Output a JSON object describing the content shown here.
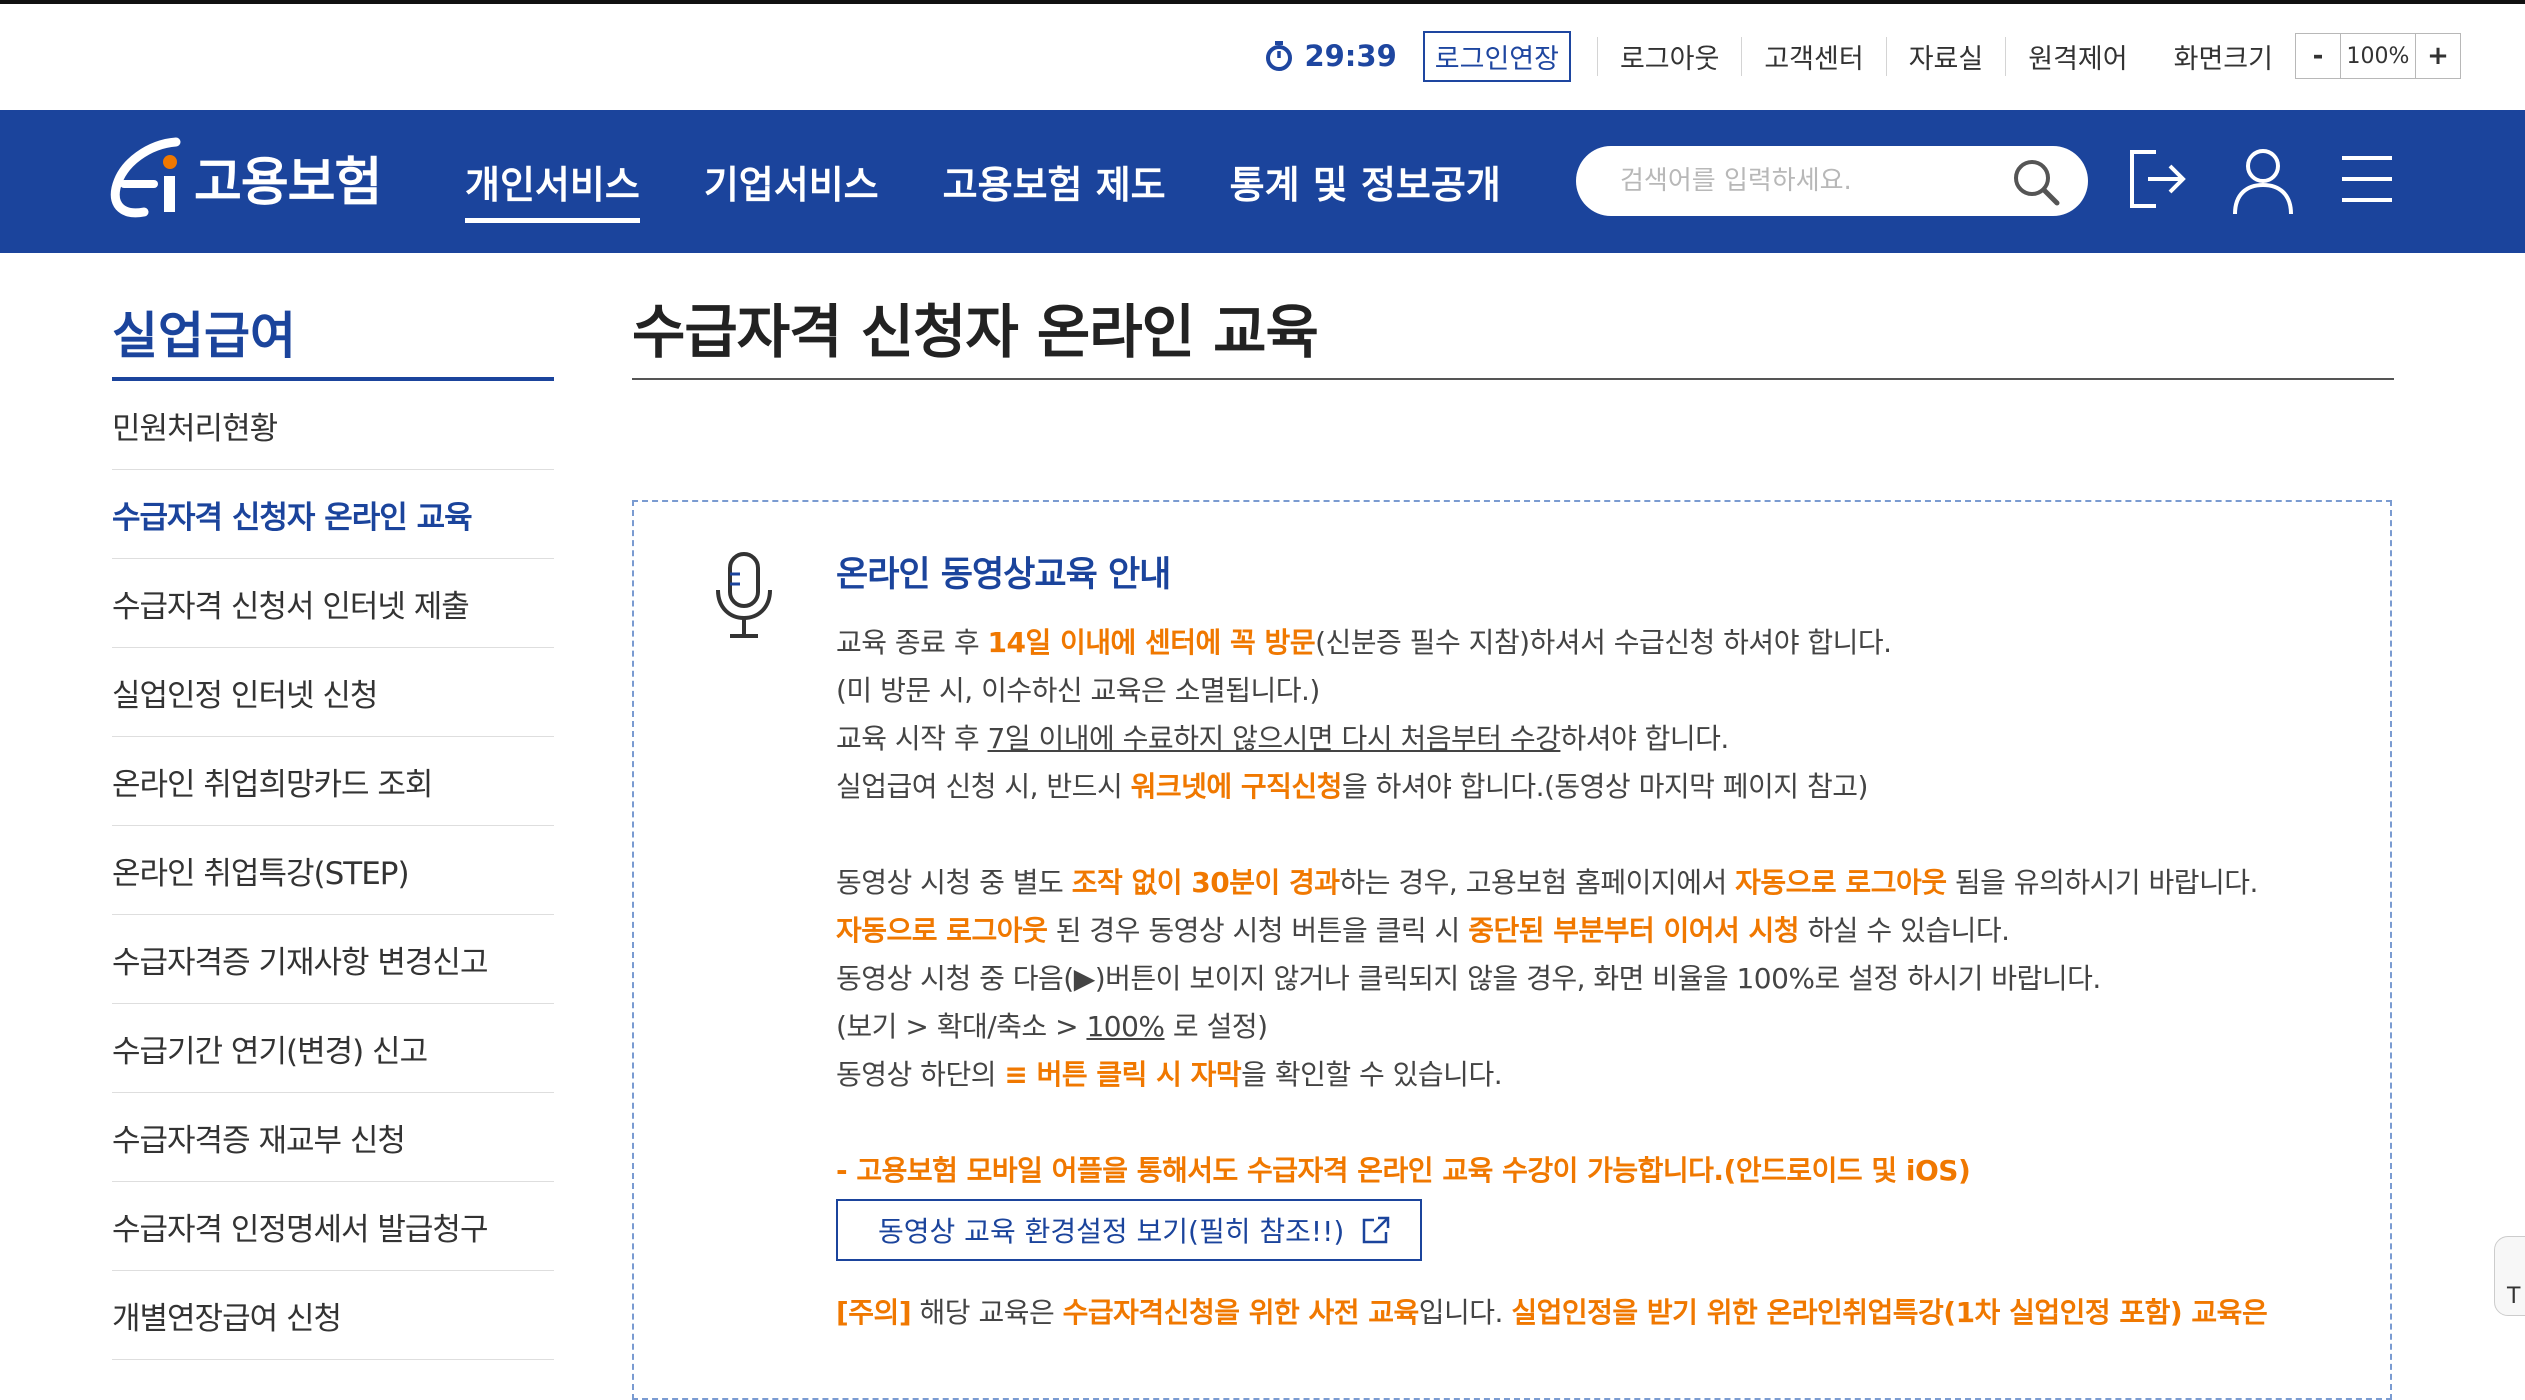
{
  "utility": {
    "timer": "29:39",
    "extend_label": "로그인연장",
    "links": [
      "로그아웃",
      "고객센터",
      "자료실",
      "원격제어"
    ],
    "zoom_label": "화면크기",
    "zoom_minus": "-",
    "zoom_value": "100%",
    "zoom_plus": "+"
  },
  "header": {
    "logo_text": "고용보험",
    "nav": [
      "개인서비스",
      "기업서비스",
      "고용보험 제도",
      "통계 및 정보공개"
    ],
    "search_placeholder": "검색어를 입력하세요.",
    "brand_color": "#1b449c"
  },
  "sidebar": {
    "title": "실업급여",
    "items": [
      "민원처리현황",
      "수급자격 신청자 온라인 교육",
      "수급자격 신청서 인터넷 제출",
      "실업인정 인터넷 신청",
      "온라인 취업희망카드 조회",
      "온라인 취업특강(STEP)",
      "수급자격증 기재사항 변경신고",
      "수급기간 연기(변경) 신고",
      "수급자격증 재교부 신청",
      "수급자격 인정명세서 발급청구",
      "개별연장급여 신청"
    ]
  },
  "main": {
    "title": "수급자격 신청자 온라인 교육",
    "notice": {
      "heading": "온라인 동영상교육 안내",
      "p1": {
        "a": "교육 종료 후 ",
        "b": "14일 이내에 센터에 꼭 방문",
        "c": "(신분증 필수 지참)하셔서 수급신청 하셔야 합니다."
      },
      "p2": "(미 방문 시, 이수하신 교육은 소멸됩니다.)",
      "p3": {
        "a": "교육 시작 후 ",
        "b": "7일 이내에 수료하지 않으시면 다시 처음부터 수강",
        "c": "하셔야 합니다."
      },
      "p4": {
        "a": "실업급여 신청 시, 반드시 ",
        "b": "워크넷에 구직신청",
        "c": "을 하셔야 합니다.(동영상 마지막 페이지 참고)"
      },
      "p5": {
        "a": "동영상 시청 중 별도 ",
        "b": "조작 없이 30분이 경과",
        "c": "하는 경우, 고용보험 홈페이지에서 ",
        "d": "자동으로 로그아웃",
        "e": " 됨을 유의하시기 바랍니다."
      },
      "p6": {
        "a": "자동으로 로그아웃",
        "b": " 된 경우 동영상 시청 버튼을 클릭 시 ",
        "c": "중단된 부분부터 이어서 시청",
        "d": " 하실 수 있습니다."
      },
      "p7": "동영상 시청 중 다음(▶)버튼이 보이지 않거나 클릭되지 않을 경우, 화면 비율을 100%로 설정 하시기 바랍니다.",
      "p8": {
        "a": "(보기 > 확대/축소 > ",
        "b": "100%",
        "c": " 로 설정)"
      },
      "p9": {
        "a": "동영상 하단의 ",
        "b": "≡ 버튼 클릭 시 자막",
        "c": "을 확인할 수 있습니다."
      },
      "mobile_note": "- 고용보험 모바일 어플을 통해서도 수급자격 온라인 교육 수강이 가능합니다.(안드로이드 및 iOS)",
      "settings_button": "동영상 교육 환경설정 보기(필히 참조!!)",
      "caution": {
        "a": "[주의]",
        "b": " 해당 교육은 ",
        "c": "수급자격신청을 위한 사전 교육",
        "d": "입니다. ",
        "e": "실업인정을 받기 위한 온라인취업특강(1차 실업인정 포함) 교육은"
      },
      "highlight_color": "#f07800"
    }
  },
  "floating": {
    "top_label": "T"
  }
}
